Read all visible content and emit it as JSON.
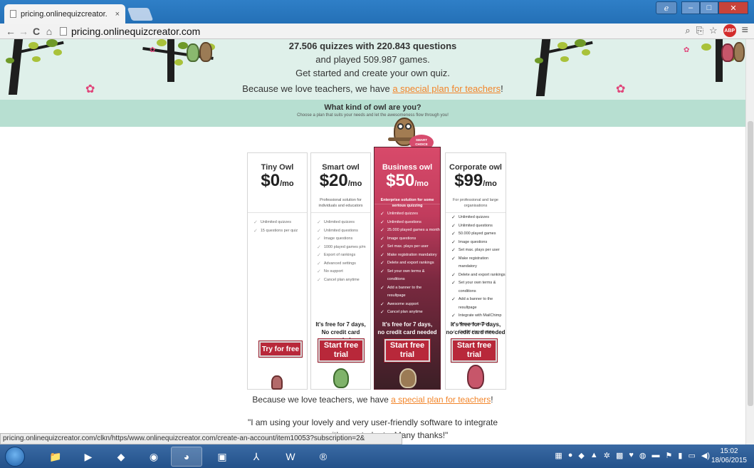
{
  "browser": {
    "tab_title": "pricing.onlinequizcreator.",
    "tab_close": "×",
    "url": "pricing.onlinequizcreator.com",
    "nav": {
      "back": "←",
      "forward": "→",
      "reload": "C",
      "home": "⌂"
    },
    "abp_label": "ABP",
    "menu_icon": "≡"
  },
  "hero": {
    "line1": "27.506 quizzes with 220.843 questions",
    "line2": "and played 509.987 games.",
    "line3": "Get started and create your own quiz.",
    "teachers_prefix": "Because we love teachers, we have ",
    "teachers_link": "a special plan for teachers",
    "teachers_suffix": "!"
  },
  "owl_section": {
    "title": "What kind of owl are you?",
    "subtitle": "Choose a plan that suits your needs and let the awesomeness flow through you!"
  },
  "plans": [
    {
      "name": "Tiny Owl",
      "price": "$0",
      "unit": "/mo",
      "description": "",
      "features": [
        "Unlimited quizzes",
        "15 questions per quiz"
      ],
      "cta": "Try for free"
    },
    {
      "name": "Smart owl",
      "price": "$20",
      "unit": "/mo",
      "description": "Professional solution for individuals and educators",
      "features": [
        "Unlimited quizzes",
        "Unlimited questions",
        "Image questions",
        "1000 played games p/m",
        "Export of rankings",
        "Advanced settings",
        "No support",
        "Cancel plan anytime"
      ],
      "free_note1": "It's free for 7 days,",
      "free_note2": "No credit card needed",
      "cta": "Start free trial"
    },
    {
      "name": "Business owl",
      "price": "$50",
      "unit": "/mo",
      "description": "Enterprise solution for some serious quizzing",
      "badge": "SMART CHOICE",
      "features": [
        "Unlimited quizzes",
        "Unlimited questions",
        "25.000 played games a month",
        "Image questions",
        "Set max. plays per user",
        "Make registration mandatory",
        "Delete and export rankings",
        "Set your own terms & conditions",
        "Add a banner to the resultpage",
        "Awesome support",
        "Cancel plan anytime"
      ],
      "free_note1": "It's free for 7 days,",
      "free_note2": "no credit card needed",
      "cta": "Start free trial"
    },
    {
      "name": "Corporate owl",
      "price": "$99",
      "unit": "/mo",
      "description": "For professional and large organisations",
      "features": [
        "Unlimited quizzes",
        "Unlimited questions",
        "50.000 played games",
        "Image questions",
        "Set max. plays per user",
        "Make registration mandatory",
        "Delete and export rankings",
        "Set your own terms & conditions",
        "Add a banner to the resultpage",
        "Integrate with MailChimp",
        "Awesome support",
        "Cancel plan anytime"
      ],
      "free_note1": "It's free for 7 days,",
      "free_note2": "no credit card needed",
      "cta": "Start free trial"
    }
  ],
  "bottom": {
    "teachers_prefix": "Because we love teachers, we have ",
    "teachers_link": "a special plan for teachers",
    "teachers_suffix": "!",
    "quote_line1": "\"I am using your lovely and very user-friendly software to integrate",
    "quote_line2": "with my students. Many thanks!\""
  },
  "status_bar": "pricing.onlinequizcreator.com/clkn/https/www.onlinequizcreator.com/create-an-account/item10053?subscription=2&",
  "taskbar": {
    "time": "15:02",
    "date": "18/06/2015"
  },
  "colors": {
    "accent": "#b8283a",
    "hero_bg": "#dff0ea",
    "band_bg": "#b7dfd1",
    "link": "#f2852a"
  }
}
